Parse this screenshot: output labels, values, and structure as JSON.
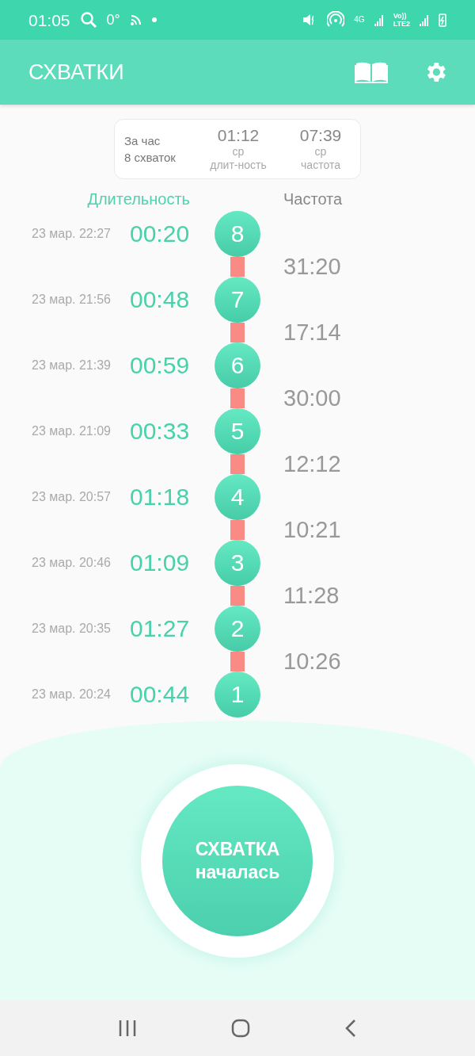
{
  "status_bar": {
    "time": "01:05",
    "temperature": "0°",
    "network": "4G",
    "volte_top": "Vo))",
    "volte_bottom": "LTE2"
  },
  "app_bar": {
    "title": "СХВАТКИ"
  },
  "summary": {
    "period": "За час",
    "count": "8 схваток",
    "stats": [
      {
        "value": "01:12",
        "line1": "ср",
        "line2": "длит-ность"
      },
      {
        "value": "07:39",
        "line1": "ср",
        "line2": "частота"
      }
    ]
  },
  "columns": [
    {
      "label": "Длительность",
      "selected": true
    },
    {
      "label": "Частота",
      "selected": false
    }
  ],
  "contractions": [
    {
      "date": "23 мар. 22:27",
      "duration": "00:20",
      "number": "8",
      "interval": "31:20"
    },
    {
      "date": "23 мар. 21:56",
      "duration": "00:48",
      "number": "7",
      "interval": "17:14"
    },
    {
      "date": "23 мар. 21:39",
      "duration": "00:59",
      "number": "6",
      "interval": "30:00"
    },
    {
      "date": "23 мар. 21:09",
      "duration": "00:33",
      "number": "5",
      "interval": "12:12"
    },
    {
      "date": "23 мар. 20:57",
      "duration": "01:18",
      "number": "4",
      "interval": "10:21"
    },
    {
      "date": "23 мар. 20:46",
      "duration": "01:09",
      "number": "3",
      "interval": "11:28"
    },
    {
      "date": "23 мар. 20:35",
      "duration": "01:27",
      "number": "2",
      "interval": "10:26"
    },
    {
      "date": "23 мар. 20:24",
      "duration": "00:44",
      "number": "1"
    }
  ],
  "start_button": {
    "line1": "СХВАТКА",
    "line2": "началась"
  }
}
